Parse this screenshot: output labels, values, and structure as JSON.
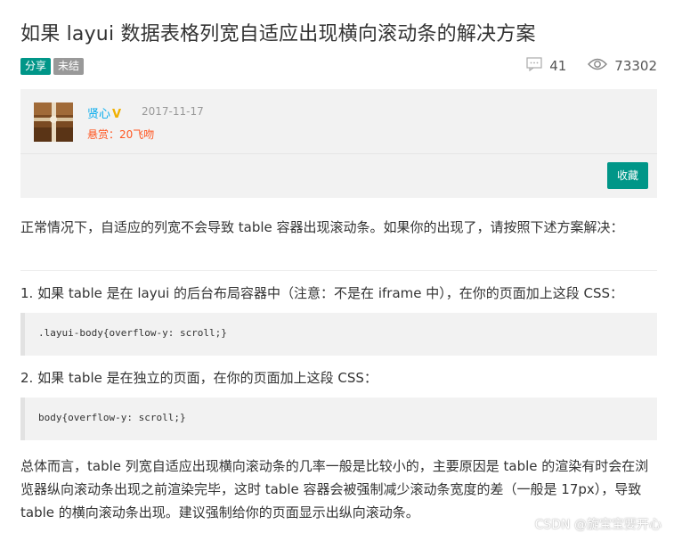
{
  "title": "如果 layui 数据表格列宽自适应出现横向滚动条的解决方案",
  "tags": [
    "分享",
    "未结"
  ],
  "stats": {
    "comments": "41",
    "views": "73302"
  },
  "author": {
    "name": "贤心",
    "badge": "V",
    "date": "2017-11-17",
    "reward": "悬赏：20飞吻"
  },
  "collect_label": "收藏",
  "content": {
    "intro": "正常情况下，自适应的列宽不会导致 table 容器出现滚动条。如果你的出现了，请按照下述方案解决：",
    "step1": "1. 如果 table 是在 layui 的后台布局容器中（注意：不是在 iframe 中），在你的页面加上这段 CSS：",
    "code1": ".layui-body{overflow-y: scroll;}",
    "step2": "2. 如果 table 是在独立的页面，在你的页面加上这段 CSS：",
    "code2": "body{overflow-y: scroll;}",
    "summary": "总体而言，table 列宽自适应出现横向滚动条的几率一般是比较小的，主要原因是 table 的渲染有时会在浏览器纵向滚动条出现之前渲染完毕，这时 table 容器会被强制减少滚动条宽度的差（一般是 17px），导致 table 的横向滚动条出现。建议强制给你的页面显示出纵向滚动条。"
  },
  "watermark": "CSDN @旋宝宝要开心",
  "colors": {
    "accent": "#009688",
    "link": "#01aaed",
    "reward": "#ff5722",
    "badge": "#f0b000"
  }
}
